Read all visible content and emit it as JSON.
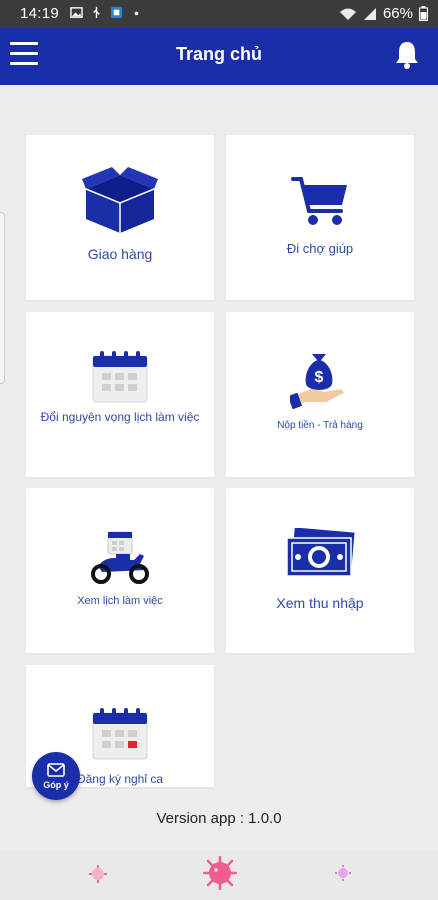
{
  "status_bar": {
    "time": "14:19",
    "battery": "66%",
    "notification_icons": [
      "image-icon",
      "usb-icon",
      "app-icon",
      "dot-icon"
    ]
  },
  "app_bar": {
    "title": "Trang chủ",
    "left_icon": "menu-icon",
    "right_icon": "bell-icon"
  },
  "menu": [
    {
      "id": "giao-hang",
      "label": "Giao hàng",
      "icon": "box-icon"
    },
    {
      "id": "di-cho-giup",
      "label": "Đi chợ giúp",
      "icon": "cart-icon"
    },
    {
      "id": "doi-nguyen-vong",
      "label": "Đổi nguyện vọng lịch làm việc",
      "icon": "calendar-icon"
    },
    {
      "id": "nop-tien",
      "label": "Nộp tiền - Trả hàng",
      "icon": "money-bag-hand-icon"
    },
    {
      "id": "xem-lich",
      "label": "Xem lịch làm việc",
      "icon": "motorbike-calendar-icon"
    },
    {
      "id": "xem-thu-nhap",
      "label": "Xem thu nhập",
      "icon": "banknote-icon"
    },
    {
      "id": "dang-ky-nghi",
      "label": "Đăng ký nghỉ ca",
      "icon": "calendar-red-icon"
    }
  ],
  "feedback": {
    "label": "Góp ý",
    "icon": "mail-icon"
  },
  "version": "Version app : 1.0.0",
  "colors": {
    "primary": "#1b2eaa",
    "label": "#2f4aa8",
    "background": "#ededed",
    "card": "#ffffff",
    "accent_red": "#e8232e",
    "bottom_icon_pink": "#f06292"
  }
}
